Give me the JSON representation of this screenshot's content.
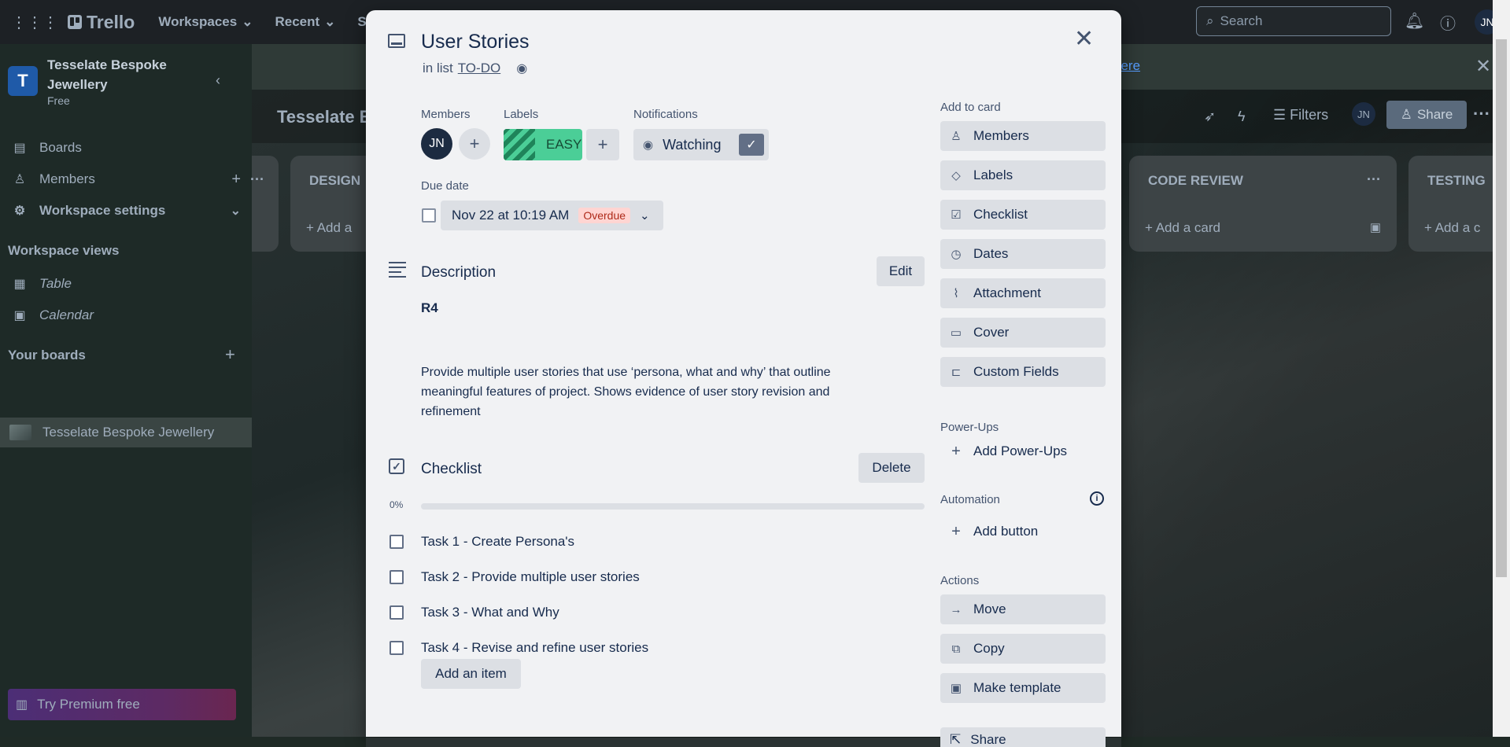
{
  "topbar": {
    "logo": "Trello",
    "workspaces": "Workspaces",
    "recent": "Recent",
    "starred_partial": "St",
    "search_placeholder": "Search",
    "user_initials": "JN"
  },
  "sidebar": {
    "workspace_initial": "T",
    "workspace_name": "Tesselate Bespoke Jewellery",
    "workspace_plan": "Free",
    "items": [
      {
        "label": "Boards"
      },
      {
        "label": "Members"
      },
      {
        "label": "Workspace settings"
      }
    ],
    "views_title": "Workspace views",
    "views": [
      {
        "label": "Table"
      },
      {
        "label": "Calendar"
      }
    ],
    "your_boards_title": "Your boards",
    "board_name": "Tesselate Bespoke Jewellery",
    "premium": "Try Premium free"
  },
  "board": {
    "banner_link": "here",
    "title": "Tesselate B",
    "filters": "Filters",
    "member_initials": "JN",
    "share": "Share",
    "lists": [
      {
        "title": "",
        "add": ""
      },
      {
        "title": "DESIGN",
        "add": "Add a"
      },
      {
        "title": "CODE REVIEW",
        "add": "Add a card"
      },
      {
        "title": "TESTING",
        "add": "Add a c"
      }
    ]
  },
  "modal": {
    "title": "User Stories",
    "in_list_prefix": "in list",
    "list_name": "TO-DO",
    "members_label": "Members",
    "member_initials": "JN",
    "labels_label": "Labels",
    "label_easy": "EASY",
    "notifications_label": "Notifications",
    "watching": "Watching",
    "due_label": "Due date",
    "due_date": "Nov 22 at 10:19 AM",
    "due_status": "Overdue",
    "description_title": "Description",
    "edit": "Edit",
    "description_heading": "R4",
    "description_text": "Provide multiple user stories that use ‘persona, what and why’ that outline meaningful features of project. Shows evidence of user story revision and refinement",
    "checklist_title": "Checklist",
    "delete": "Delete",
    "progress_label": "0%",
    "progress_value": 0,
    "checklist_items": [
      {
        "text": "Task 1 - Create Persona's",
        "checked": false
      },
      {
        "text": "Task 2 - Provide multiple user stories",
        "checked": false
      },
      {
        "text": "Task 3 - What and Why",
        "checked": false
      },
      {
        "text": "Task 4 - Revise and refine user stories",
        "checked": false
      }
    ],
    "add_item": "Add an item",
    "add_to_card_label": "Add to card",
    "add_to_card": [
      {
        "label": "Members",
        "icon": "person-icon"
      },
      {
        "label": "Labels",
        "icon": "tag-icon"
      },
      {
        "label": "Checklist",
        "icon": "checklist-icon"
      },
      {
        "label": "Dates",
        "icon": "clock-icon"
      },
      {
        "label": "Attachment",
        "icon": "paperclip-icon"
      },
      {
        "label": "Cover",
        "icon": "cover-icon"
      },
      {
        "label": "Custom Fields",
        "icon": "custom-fields-icon"
      }
    ],
    "powerups_label": "Power-Ups",
    "add_powerups": "Add Power-Ups",
    "automation_label": "Automation",
    "add_button": "Add button",
    "actions_label": "Actions",
    "actions": [
      {
        "label": "Move",
        "icon": "arrow-right-icon"
      },
      {
        "label": "Copy",
        "icon": "copy-icon"
      },
      {
        "label": "Make template",
        "icon": "template-icon"
      }
    ],
    "share_partial": "Share"
  },
  "colors": {
    "label_green": "#4bce97",
    "overdue_bg": "#ffd5d2",
    "overdue_text": "#ae2a19",
    "avatar": "#1c2b41"
  }
}
